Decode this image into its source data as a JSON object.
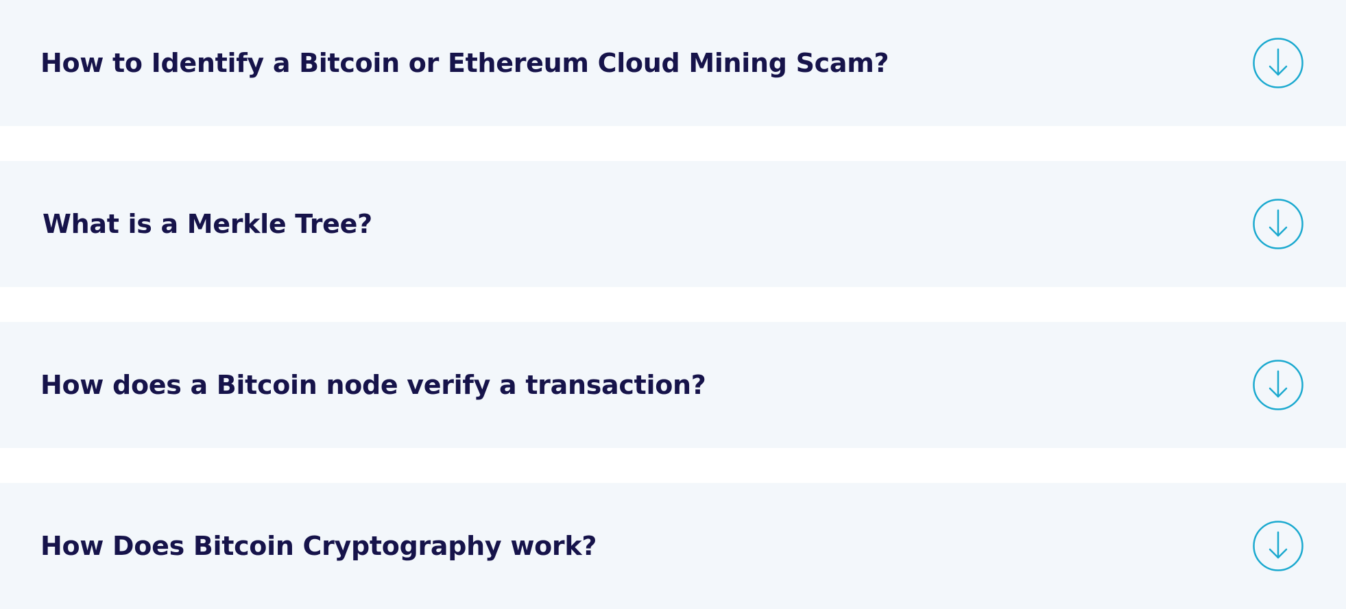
{
  "faq": {
    "items": [
      {
        "question": "How to Identify a Bitcoin or Ethereum Cloud Mining Scam?",
        "icon": "arrow-down-circle-icon"
      },
      {
        "question": "What is a Merkle Tree?",
        "icon": "arrow-down-circle-icon"
      },
      {
        "question": "How does a Bitcoin node verify a transaction?",
        "icon": "arrow-down-circle-icon"
      },
      {
        "question": "How Does Bitcoin Cryptography work?",
        "icon": "arrow-down-circle-icon"
      }
    ]
  },
  "colors": {
    "item_background": "#f3f7fb",
    "question_text": "#16134a",
    "icon_accent": "#1ba9cf",
    "page_background": "#ffffff"
  }
}
